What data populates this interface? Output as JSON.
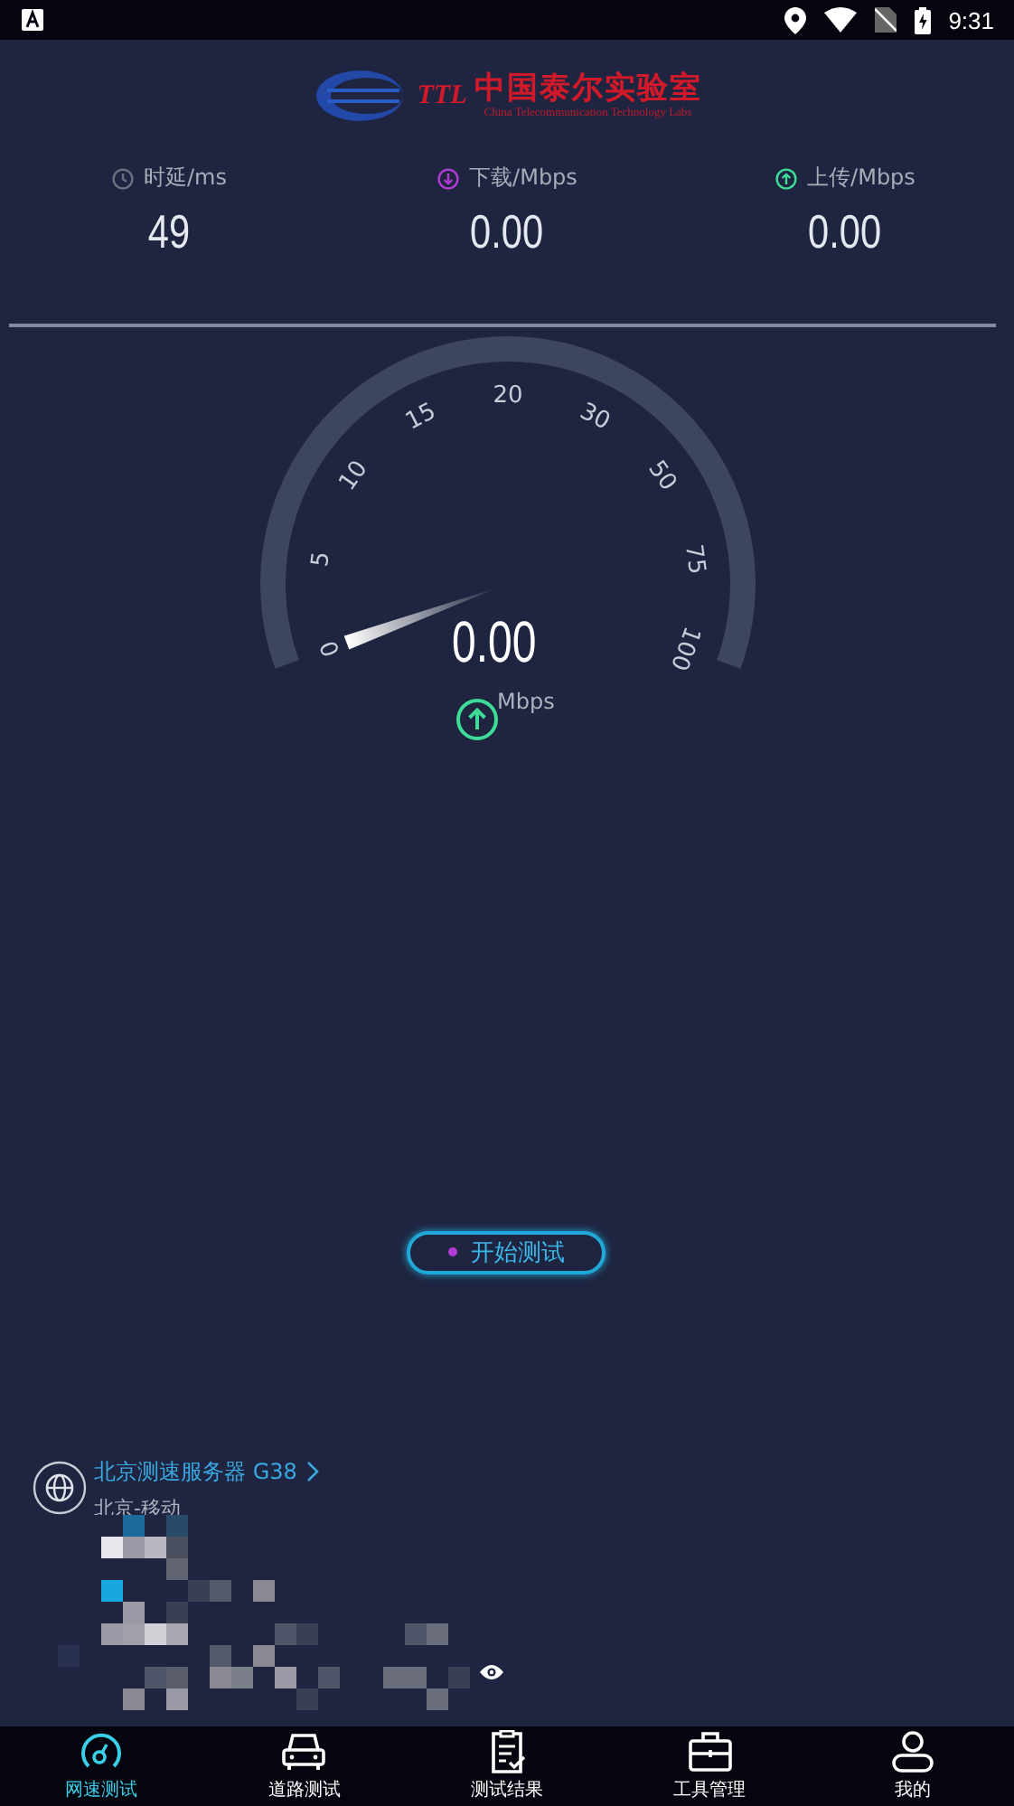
{
  "status_bar": {
    "time": "9:31"
  },
  "logo": {
    "abbr": "TTL",
    "name": "中国泰尔实验室",
    "subtitle": "China Telecommunication Technology Labs"
  },
  "stats": [
    {
      "kind": "latency",
      "label": "时延/ms",
      "value": "49"
    },
    {
      "kind": "download",
      "label": "下载/Mbps",
      "value": "0.00"
    },
    {
      "kind": "upload",
      "label": "上传/Mbps",
      "value": "0.00"
    }
  ],
  "gauge": {
    "ticks": [
      "0",
      "5",
      "10",
      "15",
      "20",
      "30",
      "50",
      "75",
      "100"
    ],
    "reading": "0.00",
    "unit": "Mbps"
  },
  "start_button": {
    "label": "开始测试"
  },
  "server": {
    "name": "北京测速服务器 G38",
    "location": "北京-移动"
  },
  "nav": [
    {
      "kind": "speed",
      "label": "网速测试",
      "selected": true
    },
    {
      "kind": "road",
      "label": "道路测试",
      "selected": false
    },
    {
      "kind": "results",
      "label": "测试结果",
      "selected": false
    },
    {
      "kind": "tools",
      "label": "工具管理",
      "selected": false
    },
    {
      "kind": "me",
      "label": "我的",
      "selected": false
    }
  ]
}
